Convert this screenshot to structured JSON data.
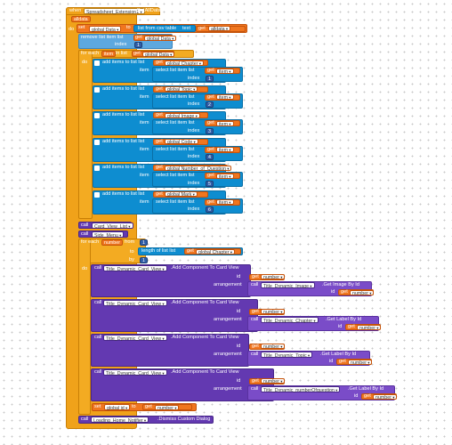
{
  "event": {
    "when": "when",
    "component": "Spreadsheet_Extension1",
    "event_name": ".GotAllData",
    "param": "alldata",
    "do": "do"
  },
  "set_data": {
    "set": "set",
    "var": "global Data",
    "to": "to",
    "func": "list from csv table",
    "text_label": "text",
    "get": "get",
    "arg": "alldata"
  },
  "remove": {
    "label": "remove list item  list",
    "get": "get",
    "var": "global Data",
    "index_label": "index",
    "index_val": "1"
  },
  "foreach1": {
    "label": "for each",
    "item": "item",
    "in_list": "in list",
    "get": "get",
    "var": "global Data",
    "do": "do"
  },
  "add_blocks": [
    {
      "label": "add items to list  list",
      "get": "get",
      "var": "global Chapter",
      "item_label": "item",
      "select_label": "select list item  list",
      "get2": "get",
      "item_var": "item",
      "index_label": "index",
      "index_val": "1"
    },
    {
      "label": "add items to list  list",
      "get": "get",
      "var": "global Topic",
      "item_label": "item",
      "select_label": "select list item  list",
      "get2": "get",
      "item_var": "item",
      "index_label": "index",
      "index_val": "2"
    },
    {
      "label": "add items to list  list",
      "get": "get",
      "var": "global Image",
      "item_label": "item",
      "select_label": "select list item  list",
      "get2": "get",
      "item_var": "item",
      "index_label": "index",
      "index_val": "3"
    },
    {
      "label": "add items to list  list",
      "get": "get",
      "var": "global Code",
      "item_label": "item",
      "select_label": "select list item  list",
      "get2": "get",
      "item_var": "item",
      "index_label": "index",
      "index_val": "4"
    },
    {
      "label": "add items to list  list",
      "get": "get",
      "var": "global Number_of_Question",
      "item_label": "item",
      "select_label": "select list item  list",
      "get2": "get",
      "item_var": "item",
      "index_label": "index",
      "index_val": "5"
    },
    {
      "label": "add items to list  list",
      "get": "get",
      "var": "global Mark",
      "item_label": "item",
      "select_label": "select list item  list",
      "get2": "get",
      "item_var": "item",
      "index_label": "index",
      "index_val": "6"
    }
  ],
  "call_cardview": {
    "call": "call",
    "comp": "Card_View_List",
    "method": ""
  },
  "call_sidemenu": {
    "call": "call",
    "comp": "Side_Menu",
    "method": ""
  },
  "foreach2": {
    "label": "for each",
    "var": "number",
    "from": "from",
    "from_val": "1",
    "to": "to",
    "length_label": "length of list  list",
    "get": "get",
    "list_var": "global Chapter",
    "by": "by",
    "by_val": "1",
    "do": "do"
  },
  "add_comp": [
    {
      "call": "call",
      "comp": "Title_Dynamic_Card_View",
      "method": ".Add Component To Card View",
      "id_label": "id",
      "get": "get",
      "id_var": "number",
      "arr_label": "arrangement",
      "inner_call": "call",
      "inner_comp": "Title_Dynamic_Image",
      "inner_method": ".Get Image By Id",
      "inner_id_label": "id",
      "inner_get": "get",
      "inner_var": "number"
    },
    {
      "call": "call",
      "comp": "Title_Dynamic_Card_View",
      "method": ".Add Component To Card View",
      "id_label": "id",
      "get": "get",
      "id_var": "number",
      "arr_label": "arrangement",
      "inner_call": "call",
      "inner_comp": "Title_Dynamic_Chapter",
      "inner_method": ".Get Label By Id",
      "inner_id_label": "id",
      "inner_get": "get",
      "inner_var": "number"
    },
    {
      "call": "call",
      "comp": "Title_Dynamic_Card_View",
      "method": ".Add Component To Card View",
      "id_label": "id",
      "get": "get",
      "id_var": "number",
      "arr_label": "arrangement",
      "inner_call": "call",
      "inner_comp": "Title_Dynamic_Topic",
      "inner_method": ".Get Label By Id",
      "inner_id_label": "id",
      "inner_get": "get",
      "inner_var": "number"
    },
    {
      "call": "call",
      "comp": "Title_Dynamic_Card_View",
      "method": ".Add Component To Card View",
      "id_label": "id",
      "get": "get",
      "id_var": "number",
      "arr_label": "arrangement",
      "inner_call": "call",
      "inner_comp": "Title_Dynamic_numberOfquestion",
      "inner_method": ".Get Label By Id",
      "inner_id_label": "id",
      "inner_get": "get",
      "inner_var": "number"
    }
  ],
  "set_id": {
    "set": "set",
    "var": "global id",
    "to": "to",
    "get": "get",
    "arg": "number"
  },
  "call_dismiss": {
    "call": "call",
    "comp": "Loading_Home_Notifier",
    "method": ".Dismiss Custom Dialog"
  }
}
